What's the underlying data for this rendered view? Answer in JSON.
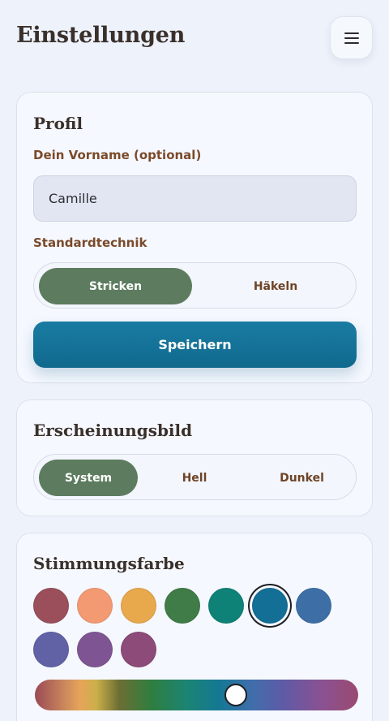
{
  "header": {
    "title": "Einstellungen"
  },
  "profile": {
    "title": "Profil",
    "name_label": "Dein Vorname (optional)",
    "name_value": "Camille",
    "technique_label": "Standardtechnik",
    "technique_options": [
      "Stricken",
      "Häkeln"
    ],
    "technique_selected": "Stricken",
    "save_label": "Speichern"
  },
  "appearance": {
    "title": "Erscheinungsbild",
    "options": [
      "System",
      "Hell",
      "Dunkel"
    ],
    "selected": "System"
  },
  "mood": {
    "title": "Stimmungsfarbe",
    "swatches": [
      "#9b4f5b",
      "#f39a73",
      "#e8a84c",
      "#3f7c48",
      "#0f8278",
      "#136f95",
      "#3d6fa6",
      "#6161a5",
      "#7e5592",
      "#8c4b78"
    ],
    "selected_index": 5,
    "hue_position": 0.63
  }
}
